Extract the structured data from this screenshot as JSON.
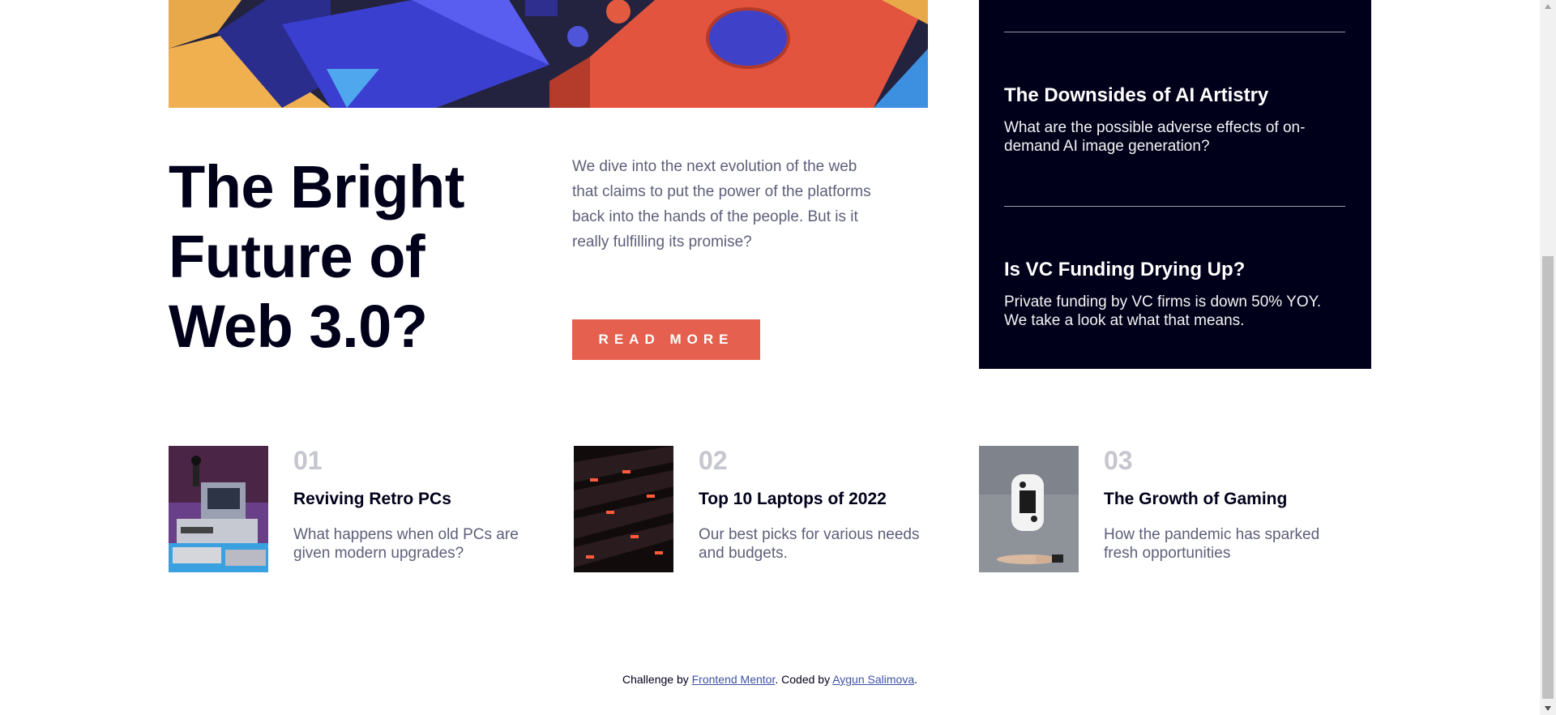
{
  "main_article": {
    "title": "The Bright Future of Web 3.0?",
    "intro": "We dive into the next evolution of the web that claims to put the power of the platforms back into the hands of the people. But is it really fulfilling its promise?",
    "button_label": "READ MORE",
    "image_icon": "abstract-3d-shapes-image"
  },
  "new_panel": {
    "items": [
      {
        "title": "The Downsides of AI Artistry",
        "description": "What are the possible adverse effects of on-demand AI image generation?"
      },
      {
        "title": "Is VC Funding Drying Up?",
        "description": "Private funding by VC firms is down 50% YOY. We take a look at what that means."
      }
    ]
  },
  "cards": [
    {
      "number": "01",
      "title": "Reviving Retro PCs",
      "description": "What happens when old PCs are given modern upgrades?",
      "image_icon": "retro-pc-image"
    },
    {
      "number": "02",
      "title": "Top 10 Laptops of 2022",
      "description": "Our best picks for various needs and budgets.",
      "image_icon": "laptop-keyboard-image"
    },
    {
      "number": "03",
      "title": "The Growth of Gaming",
      "description": "How the pandemic has sparked fresh opportunities",
      "image_icon": "game-controller-image"
    }
  ],
  "footer": {
    "prefix": "Challenge by ",
    "link1": "Frontend Mentor",
    "middle": ". Coded by ",
    "link2": "Aygun Salimova",
    "suffix": "."
  },
  "colors": {
    "accent": "#e5604e",
    "dark_navy": "#00001a",
    "grayish_blue": "#5d5f79",
    "grayish_number": "#c5c6ce"
  }
}
